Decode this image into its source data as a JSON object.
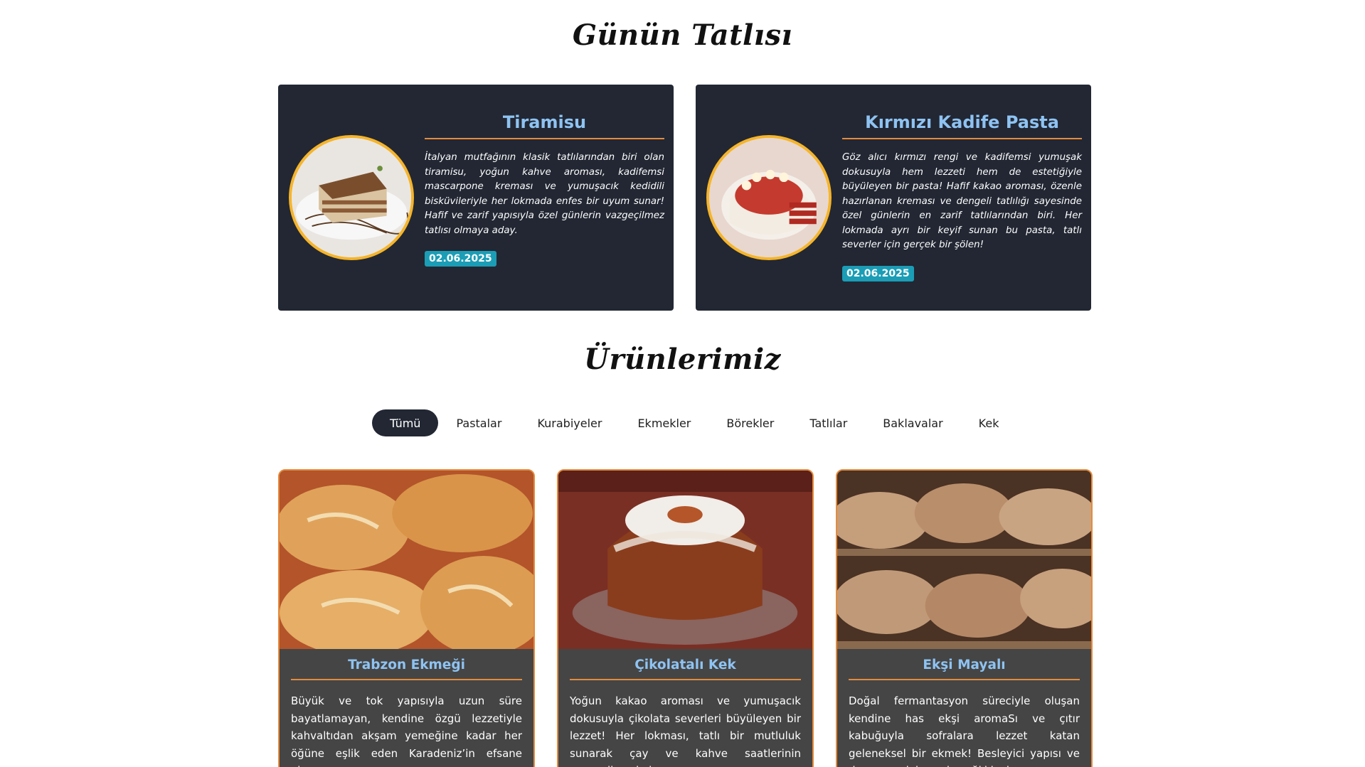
{
  "sections": {
    "daily_title": "Günün Tatlısı",
    "products_title": "Ürünlerimiz"
  },
  "daily": [
    {
      "title": "Tiramisu",
      "description": "İtalyan mutfağının klasik tatlılarından biri olan tiramisu, yoğun kahve aroması, kadifemsi mascarpone kreması ve yumuşacık kedidili bisküvileriyle her lokmada enfes bir uyum sunar! Hafif ve zarif yapısıyla özel günlerin vazgeçilmez tatlısı olmaya aday.",
      "date": "02.06.2025",
      "image_icon": "tiramisu-image"
    },
    {
      "title": "Kırmızı Kadife Pasta",
      "description": "Göz alıcı kırmızı rengi ve kadifemsi yumuşak dokusuyla hem lezzeti hem de estetiğiyle büyüleyen bir pasta! Hafif kakao aroması, özenle hazırlanan kreması ve dengeli tatlılığı sayesinde özel günlerin en zarif tatlılarından biri. Her lokmada ayrı bir keyif sunan bu pasta, tatlı severler için gerçek bir şölen!",
      "date": "02.06.2025",
      "image_icon": "red-velvet-image"
    }
  ],
  "filters": [
    {
      "label": "Tümü",
      "active": true
    },
    {
      "label": "Pastalar",
      "active": false
    },
    {
      "label": "Kurabiyeler",
      "active": false
    },
    {
      "label": "Ekmekler",
      "active": false
    },
    {
      "label": "Börekler",
      "active": false
    },
    {
      "label": "Tatlılar",
      "active": false
    },
    {
      "label": "Baklavalar",
      "active": false
    },
    {
      "label": "Kek",
      "active": false
    }
  ],
  "products": [
    {
      "title": "Trabzon Ekmeği",
      "description": "Büyük ve tok yapısıyla uzun süre bayatlamayan, kendine özgü lezzetiyle kahvaltıdan akşam yemeğine kadar her öğüne eşlik eden Karadeniz’in efsane ekme...",
      "image_icon": "bread-rolls-image"
    },
    {
      "title": "Çikolatalı Kek",
      "description": "Yoğun kakao aroması ve yumuşacık dokusuyla çikolata severleri büyüleyen bir lezzet! Her lokması, tatlı bir mutluluk sunarak çay ve kahve saatlerinin vazgeçilmezi olur.",
      "image_icon": "chocolate-bundt-cake-image"
    },
    {
      "title": "Ekşi Mayalı",
      "description": "Doğal fermantasyon süreciyle oluşan kendine has ekşi aromaSı ve çıtır kabuğuyla sofralara lezzet katan geleneksel bir ekmek! Besleyici yapısı ve doyurucu dokusuyla sağlıklı ekm...",
      "image_icon": "sourdough-loaves-image"
    }
  ],
  "colors": {
    "card_dark": "#222733",
    "accent_blue": "#8ec3f2",
    "accent_orange": "#e48b3d",
    "date_badge": "#1b9db6",
    "image_ring": "#f5b42a",
    "product_card": "#454545"
  }
}
